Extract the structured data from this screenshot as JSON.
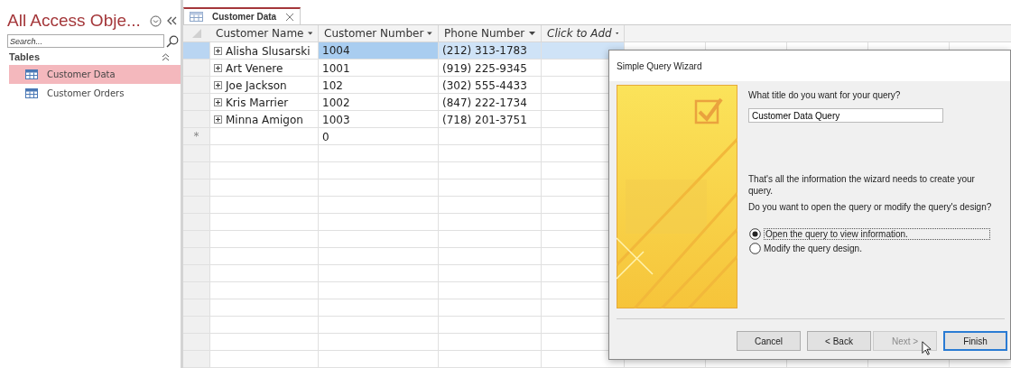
{
  "nav_pane": {
    "title": "All Access Obje...",
    "search": {
      "placeholder": "Search..."
    },
    "group": {
      "label": "Tables",
      "expanded": true
    },
    "items": [
      {
        "label": "Customer Data",
        "selected": true
      },
      {
        "label": "Customer Orders",
        "selected": false
      }
    ]
  },
  "document_tab": {
    "label": "Customer Data"
  },
  "table": {
    "columns": [
      {
        "label": "Customer Name",
        "kind": "field"
      },
      {
        "label": "Customer Number",
        "kind": "field"
      },
      {
        "label": "Phone Number",
        "kind": "field"
      },
      {
        "label": "Click to Add",
        "kind": "add"
      }
    ],
    "rows": [
      {
        "cells": [
          "Alisha Slusarski",
          "1004",
          "(212) 313-1783",
          ""
        ],
        "selected": true,
        "kind": "record"
      },
      {
        "cells": [
          "Art Venere",
          "1001",
          "(919) 225-9345",
          ""
        ],
        "selected": false,
        "kind": "record"
      },
      {
        "cells": [
          "Joe Jackson",
          "102",
          "(302) 555-4433",
          ""
        ],
        "selected": false,
        "kind": "record"
      },
      {
        "cells": [
          "Kris Marrier",
          "1002",
          "(847) 222-1734",
          ""
        ],
        "selected": false,
        "kind": "record"
      },
      {
        "cells": [
          "Minna Amigon",
          "1003",
          "(718) 201-3751",
          ""
        ],
        "selected": false,
        "kind": "record"
      },
      {
        "cells": [
          "",
          "0",
          "",
          ""
        ],
        "selected": false,
        "kind": "new",
        "marker": "*"
      }
    ]
  },
  "dialog": {
    "title": "Simple Query Wizard",
    "question": "What title do you want for your query?",
    "title_field": {
      "value": "Customer Data Query"
    },
    "info": "That's all the information the wizard needs to create your query.",
    "prompt": "Do you want to open the query or modify the query's design?",
    "options": [
      {
        "label": "Open the query to view information.",
        "selected": true
      },
      {
        "label": "Modify the query design.",
        "selected": false
      }
    ],
    "buttons": [
      {
        "label": "Cancel",
        "disabled": false,
        "default": false
      },
      {
        "label": "< Back",
        "disabled": false,
        "default": false
      },
      {
        "label": "Next >",
        "disabled": true,
        "default": false
      },
      {
        "label": "Finish",
        "disabled": false,
        "default": true
      }
    ]
  }
}
